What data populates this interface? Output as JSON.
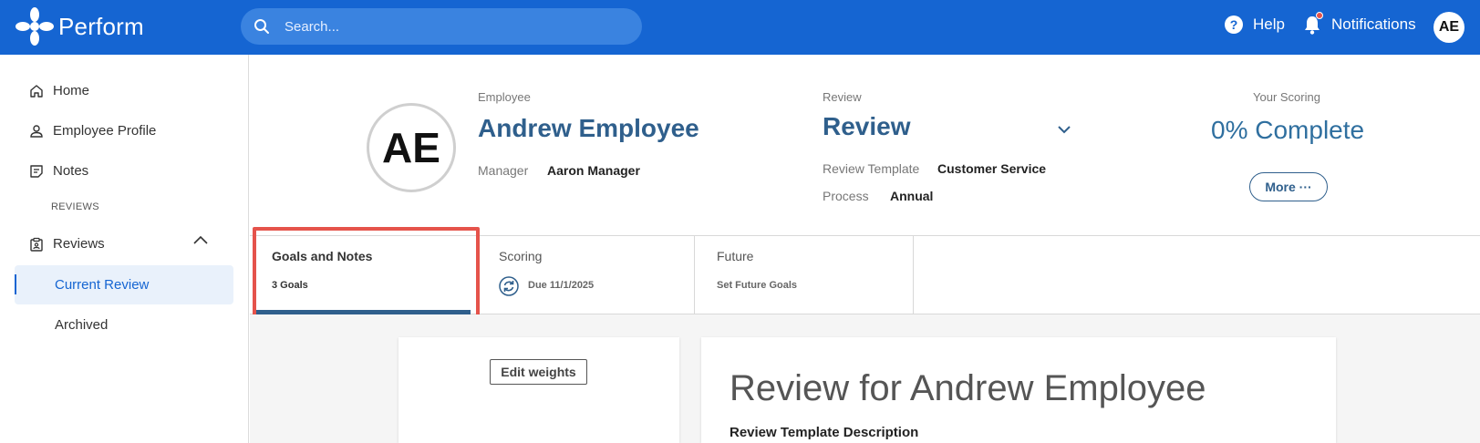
{
  "app": {
    "name": "Perform"
  },
  "search": {
    "placeholder": "Search..."
  },
  "topbar": {
    "help_label": "Help",
    "notifications_label": "Notifications",
    "user_initials": "AE"
  },
  "sidebar": {
    "home": "Home",
    "employee_profile": "Employee Profile",
    "notes": "Notes",
    "reviews_section": "REVIEWS",
    "reviews": "Reviews",
    "current_review": "Current Review",
    "archived": "Archived"
  },
  "header": {
    "avatar_initials": "AE",
    "employee_label": "Employee",
    "employee_name": "Andrew Employee",
    "manager_label": "Manager",
    "manager_name": "Aaron Manager",
    "review_label": "Review",
    "review_title": "Review",
    "template_label": "Review Template",
    "template_value": "Customer Service",
    "process_label": "Process",
    "process_value": "Annual",
    "scoring_label": "Your Scoring",
    "scoring_value": "0% Complete",
    "more_label": "More ···"
  },
  "tabs": [
    {
      "title": "Goals and Notes",
      "sub": "3 Goals"
    },
    {
      "title": "Scoring",
      "sub": "Due 11/1/2025"
    },
    {
      "title": "Future",
      "sub": "Set Future Goals"
    }
  ],
  "content": {
    "edit_weights": "Edit weights",
    "review_heading": "Review for Andrew Employee",
    "template_description_label": "Review Template Description"
  },
  "colors": {
    "brand": "#1565d2",
    "accent": "#2f5f8c",
    "highlight": "#e5534b"
  }
}
